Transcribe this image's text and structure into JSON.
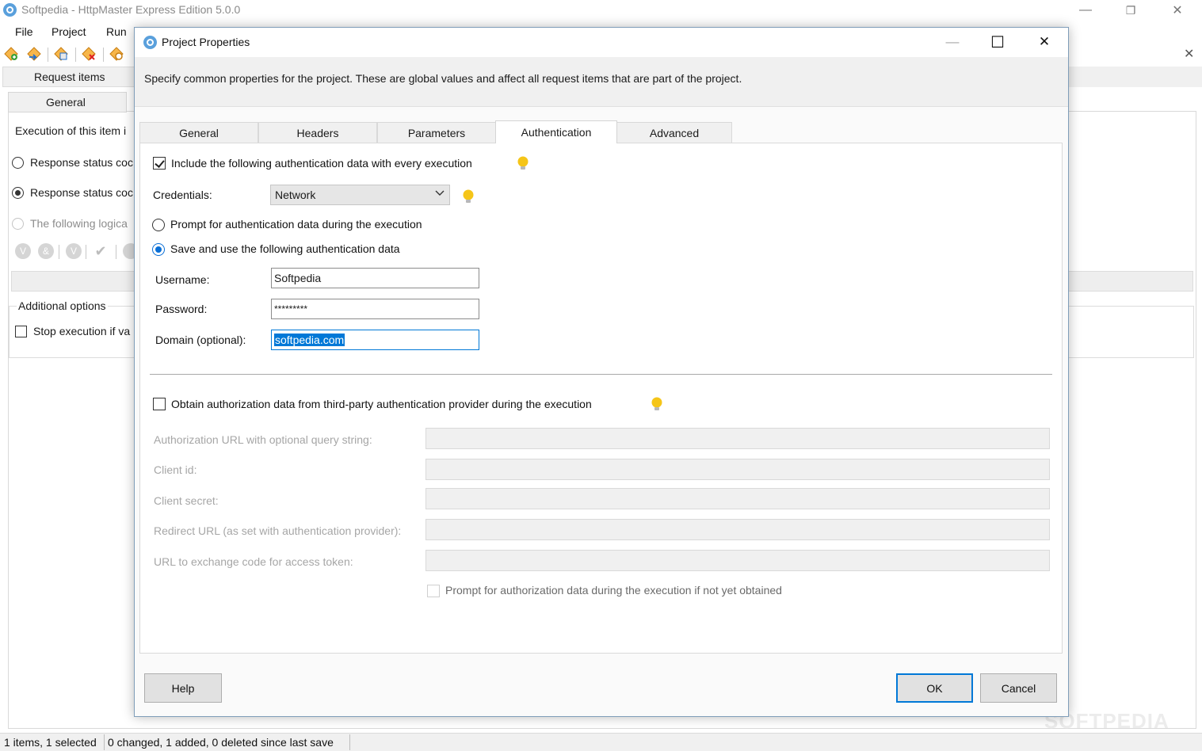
{
  "app": {
    "title": "Softpedia - HttpMaster Express Edition 5.0.0",
    "window_controls": {
      "minimize": "—",
      "restore": "❐",
      "close": "✕"
    },
    "menu": [
      "File",
      "Project",
      "Run"
    ],
    "panel_close": "✕"
  },
  "background": {
    "request_items_tab": "Request items",
    "general_tab": "General",
    "execution_label": "Execution of this item i",
    "radio_response_1": "Response status coc",
    "radio_response_2": "Response status coc",
    "radio_logical": "The following logica",
    "condition_buttons": [
      "V",
      "&",
      "V",
      "✔"
    ],
    "additional_options": "Additional options",
    "stop_execution": "Stop execution if va"
  },
  "statusbar": {
    "items": "1 items, 1 selected",
    "changes": "0 changed, 1 added, 0 deleted since last save"
  },
  "watermark": "SOFTPEDIA",
  "dialog": {
    "title": "Project Properties",
    "controls": {
      "minimize": "—",
      "maximize": "☐",
      "close": "✕"
    },
    "description": "Specify common properties for the project. These are global values and affect all request items that are part of the project.",
    "tabs": [
      "General",
      "Headers",
      "Parameters",
      "Authentication",
      "Advanced"
    ],
    "active_tab": "Authentication",
    "auth": {
      "include_label": "Include the following authentication data with every execution",
      "include_checked": true,
      "credentials_label": "Credentials:",
      "credentials_value": "Network",
      "prompt_label": "Prompt for authentication data during the execution",
      "save_label": "Save and use the following authentication data",
      "selected_mode": "save",
      "username_label": "Username:",
      "username_value": "Softpedia",
      "password_label": "Password:",
      "password_value": "*********",
      "domain_label": "Domain (optional):",
      "domain_value": "softpedia.com",
      "obtain_label": "Obtain authorization data from third-party authentication provider during the execution",
      "obtain_checked": false,
      "auth_url_label": "Authorization URL with optional query string:",
      "client_id_label": "Client id:",
      "client_secret_label": "Client secret:",
      "redirect_url_label": "Redirect URL (as set with authentication provider):",
      "exchange_url_label": "URL to exchange code for access token:",
      "prompt_if_not_obtained_label": "Prompt for authorization data during the execution if not yet obtained"
    },
    "buttons": {
      "help": "Help",
      "ok": "OK",
      "cancel": "Cancel"
    }
  },
  "colors": {
    "accent": "#0078d7",
    "hint_bulb": "#f5c518",
    "dialog_border": "#7f9db9"
  }
}
